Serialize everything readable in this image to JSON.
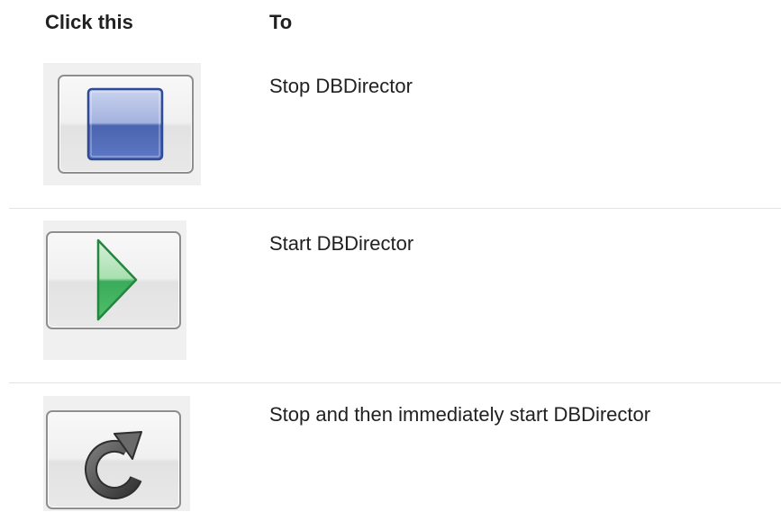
{
  "table": {
    "headers": {
      "click": "Click this",
      "to": "To"
    },
    "rows": [
      {
        "icon": "stop-icon",
        "description": "Stop DBDirector"
      },
      {
        "icon": "play-icon",
        "description": "Start DBDirector"
      },
      {
        "icon": "restart-icon",
        "description": "Stop and then immediately start DBDirector"
      }
    ]
  },
  "colors": {
    "stop": "#4a64b0",
    "play": "#3aab5a",
    "restart": "#555555"
  }
}
